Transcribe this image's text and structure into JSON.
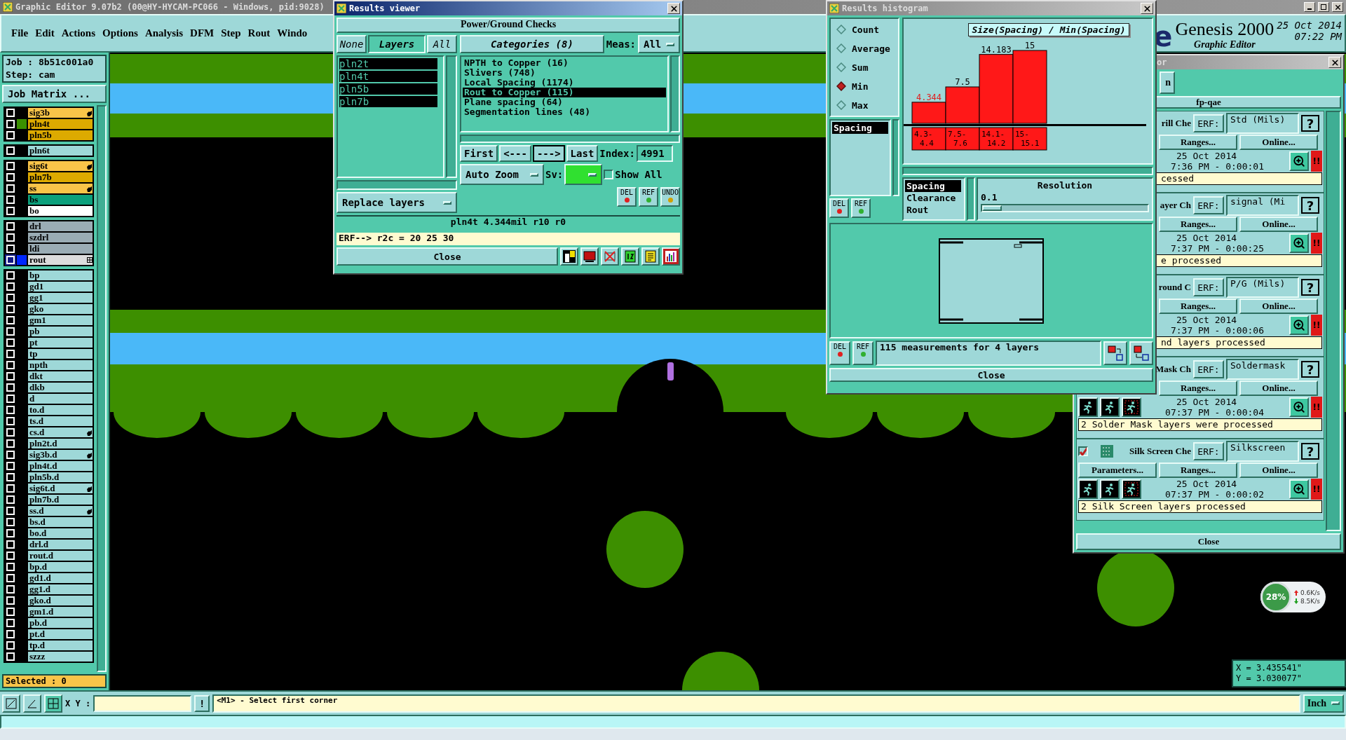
{
  "window": {
    "title": "Graphic Editor 9.07b2 (00@HY-HYCAM-PC066 - Windows, pid:9028)"
  },
  "menu": [
    "File",
    "Edit",
    "Actions",
    "Options",
    "Analysis",
    "DFM",
    "Step",
    "Rout",
    "Windo"
  ],
  "logo": {
    "fragment": "e",
    "name": "Genesis 2000",
    "subtitle": "Graphic Editor",
    "date": "25 Oct 2014",
    "time": "07:22 PM"
  },
  "job_panel": {
    "job": "Job : 8b51c001a0",
    "step": "Step: cam",
    "matrix_button": "Job Matrix ...",
    "selected_count": "Selected : 0",
    "layer_groups": [
      [
        {
          "name": "sig3b",
          "color": "#f9c449",
          "checked": false,
          "shown": false,
          "work": false,
          "flagged": true
        },
        {
          "name": "pln4t",
          "color": "#ddaa00",
          "checked": false,
          "shown": true,
          "work": false,
          "flagged": false
        },
        {
          "name": "pln5b",
          "color": "#ddaa00",
          "checked": false,
          "shown": false,
          "work": false,
          "flagged": false
        }
      ],
      [
        {
          "name": "pln6t",
          "color": "#9ed8d8",
          "checked": false,
          "shown": false,
          "work": false,
          "flagged": false
        }
      ],
      [
        {
          "name": "sig6t",
          "color": "#f9c449",
          "checked": false,
          "shown": false,
          "work": false,
          "flagged": true
        },
        {
          "name": "pln7b",
          "color": "#ddaa00",
          "checked": false,
          "shown": false,
          "work": false,
          "flagged": false
        },
        {
          "name": "ss",
          "color": "#f9c449",
          "checked": false,
          "shown": false,
          "work": false,
          "flagged": true
        },
        {
          "name": "bs",
          "color": "#0ca07c",
          "checked": false,
          "shown": false,
          "work": false,
          "flagged": false
        },
        {
          "name": "bo",
          "color": "#ffffff",
          "checked": false,
          "shown": false,
          "work": false,
          "flagged": false
        }
      ],
      [
        {
          "name": "drl",
          "color": "#9aacb4",
          "checked": false,
          "shown": false,
          "work": false,
          "flagged": false
        },
        {
          "name": "szdrl",
          "color": "#9aacb4",
          "checked": false,
          "shown": false,
          "work": false,
          "flagged": false
        },
        {
          "name": "ldi",
          "color": "#9aacb4",
          "checked": false,
          "shown": false,
          "work": false,
          "flagged": false
        },
        {
          "name": "rout",
          "color": "#dcdcdc",
          "checked": false,
          "shown": false,
          "work": true,
          "flagged": false
        }
      ],
      [
        {
          "name": "bp",
          "color": "#9ed8d8",
          "checked": false,
          "shown": false,
          "work": false,
          "flagged": false
        },
        {
          "name": "gd1",
          "color": "#9ed8d8",
          "checked": false,
          "shown": false,
          "work": false,
          "flagged": false
        },
        {
          "name": "gg1",
          "color": "#9ed8d8",
          "checked": false,
          "shown": false,
          "work": false,
          "flagged": false
        },
        {
          "name": "gko",
          "color": "#9ed8d8",
          "checked": false,
          "shown": false,
          "work": false,
          "flagged": false
        },
        {
          "name": "gm1",
          "color": "#9ed8d8",
          "checked": false,
          "shown": false,
          "work": false,
          "flagged": false
        },
        {
          "name": "pb",
          "color": "#9ed8d8",
          "checked": false,
          "shown": false,
          "work": false,
          "flagged": false
        },
        {
          "name": "pt",
          "color": "#9ed8d8",
          "checked": false,
          "shown": false,
          "work": false,
          "flagged": false
        },
        {
          "name": "tp",
          "color": "#9ed8d8",
          "checked": false,
          "shown": false,
          "work": false,
          "flagged": false
        },
        {
          "name": "npth",
          "color": "#9ed8d8",
          "checked": false,
          "shown": false,
          "work": false,
          "flagged": false
        },
        {
          "name": "dkt",
          "color": "#9ed8d8",
          "checked": false,
          "shown": false,
          "work": false,
          "flagged": false
        },
        {
          "name": "dkb",
          "color": "#9ed8d8",
          "checked": false,
          "shown": false,
          "work": false,
          "flagged": false
        },
        {
          "name": "d",
          "color": "#9ed8d8",
          "checked": false,
          "shown": false,
          "work": false,
          "flagged": false
        },
        {
          "name": "to.d",
          "color": "#9ed8d8",
          "checked": false,
          "shown": false,
          "work": false,
          "flagged": false
        },
        {
          "name": "ts.d",
          "color": "#9ed8d8",
          "checked": false,
          "shown": false,
          "work": false,
          "flagged": false
        },
        {
          "name": "cs.d",
          "color": "#9ed8d8",
          "checked": false,
          "shown": false,
          "work": false,
          "flagged": true
        },
        {
          "name": "pln2t.d",
          "color": "#9ed8d8",
          "checked": false,
          "shown": false,
          "work": false,
          "flagged": false
        },
        {
          "name": "sig3b.d",
          "color": "#9ed8d8",
          "checked": false,
          "shown": false,
          "work": false,
          "flagged": true
        },
        {
          "name": "pln4t.d",
          "color": "#9ed8d8",
          "checked": false,
          "shown": false,
          "work": false,
          "flagged": false
        },
        {
          "name": "pln5b.d",
          "color": "#9ed8d8",
          "checked": false,
          "shown": false,
          "work": false,
          "flagged": false
        },
        {
          "name": "sig6t.d",
          "color": "#9ed8d8",
          "checked": false,
          "shown": false,
          "work": false,
          "flagged": true
        },
        {
          "name": "pln7b.d",
          "color": "#9ed8d8",
          "checked": false,
          "shown": false,
          "work": false,
          "flagged": false
        },
        {
          "name": "ss.d",
          "color": "#9ed8d8",
          "checked": false,
          "shown": false,
          "work": false,
          "flagged": true
        },
        {
          "name": "bs.d",
          "color": "#9ed8d8",
          "checked": false,
          "shown": false,
          "work": false,
          "flagged": false
        },
        {
          "name": "bo.d",
          "color": "#9ed8d8",
          "checked": false,
          "shown": false,
          "work": false,
          "flagged": false
        },
        {
          "name": "drl.d",
          "color": "#9ed8d8",
          "checked": false,
          "shown": false,
          "work": false,
          "flagged": false
        },
        {
          "name": "rout.d",
          "color": "#9ed8d8",
          "checked": false,
          "shown": false,
          "work": false,
          "flagged": false
        },
        {
          "name": "bp.d",
          "color": "#9ed8d8",
          "checked": false,
          "shown": false,
          "work": false,
          "flagged": false
        },
        {
          "name": "gd1.d",
          "color": "#9ed8d8",
          "checked": false,
          "shown": false,
          "work": false,
          "flagged": false
        },
        {
          "name": "gg1.d",
          "color": "#9ed8d8",
          "checked": false,
          "shown": false,
          "work": false,
          "flagged": false
        },
        {
          "name": "gko.d",
          "color": "#9ed8d8",
          "checked": false,
          "shown": false,
          "work": false,
          "flagged": false
        },
        {
          "name": "gm1.d",
          "color": "#9ed8d8",
          "checked": false,
          "shown": false,
          "work": false,
          "flagged": false
        },
        {
          "name": "pb.d",
          "color": "#9ed8d8",
          "checked": false,
          "shown": false,
          "work": false,
          "flagged": false
        },
        {
          "name": "pt.d",
          "color": "#9ed8d8",
          "checked": false,
          "shown": false,
          "work": false,
          "flagged": false
        },
        {
          "name": "tp.d",
          "color": "#9ed8d8",
          "checked": false,
          "shown": false,
          "work": false,
          "flagged": false
        },
        {
          "name": "szzz",
          "color": "#9ed8d8",
          "checked": false,
          "shown": false,
          "work": false,
          "flagged": false
        }
      ]
    ]
  },
  "results_viewer": {
    "title": "Results viewer",
    "header": "Power/Ground Checks",
    "layer_tabs": [
      {
        "label": "None",
        "selected": false
      },
      {
        "label": "Layers",
        "selected": true
      },
      {
        "label": "All",
        "selected": false
      }
    ],
    "layers": [
      {
        "name": "pln2t",
        "selected": true
      },
      {
        "name": "pln4t",
        "selected": true
      },
      {
        "name": "pln5b",
        "selected": true
      },
      {
        "name": "pln7b",
        "selected": true
      }
    ],
    "layer_action": "Replace layers",
    "categories_title": "Categories (8)",
    "meas_label": "Meas:",
    "meas_value": "All",
    "categories": [
      {
        "label": "NPTH to Copper (16)",
        "selected": false
      },
      {
        "label": "Slivers (748)",
        "selected": false
      },
      {
        "label": "Local Spacing (1174)",
        "selected": false
      },
      {
        "label": "Rout to Copper (115)",
        "selected": true
      },
      {
        "label": "Plane spacing (64)",
        "selected": false
      },
      {
        "label": "Segmentation lines (48)",
        "selected": false
      }
    ],
    "nav": [
      {
        "label": "First",
        "selected": false
      },
      {
        "label": "<---",
        "selected": false
      },
      {
        "label": "--->",
        "selected": true
      },
      {
        "label": "Last",
        "selected": false
      }
    ],
    "index_label": "Index:",
    "index_value": "4991",
    "zoom_mode": "Auto Zoom",
    "sv_label": "Sv:",
    "show_all": {
      "label": "Show All",
      "checked": false
    },
    "tool_buttons": [
      "DEL",
      "REF",
      "UNDO"
    ],
    "info": "pln4t 4.344mil r10 r0",
    "erf": "ERF--> r2c = 20 25 30",
    "close": "Close"
  },
  "histogram": {
    "title": "Results histogram",
    "modes": [
      {
        "label": "Count",
        "selected": false
      },
      {
        "label": "Average",
        "selected": false
      },
      {
        "label": "Sum",
        "selected": false
      },
      {
        "label": "Min",
        "selected": true
      },
      {
        "label": "Max",
        "selected": false
      }
    ],
    "measures": [
      {
        "label": "Spacing",
        "selected": true
      }
    ],
    "chart_data": {
      "type": "bar",
      "title": "Size(Spacing) / Min(Spacing)",
      "categories": [
        "4.3- 4.4",
        "7.5- 7.6",
        "14.1- 14.2",
        "15- 15.1"
      ],
      "values": [
        4.344,
        7.5,
        14.183,
        15
      ],
      "data_labels": true
    },
    "types": [
      {
        "label": "Spacing",
        "selected": true
      },
      {
        "label": "Clearance",
        "selected": false
      },
      {
        "label": "Rout",
        "selected": false
      }
    ],
    "resolution_label": "Resolution",
    "resolution_value": "0.1",
    "resolution": {
      "level": 0.0
    },
    "list_buttons": [
      "DEL",
      "REF"
    ],
    "summary_buttons": [
      "DEL",
      "REF"
    ],
    "summary": "115 measurements for 4 layers",
    "close": "Close"
  },
  "checks_window": {
    "title": "or",
    "top_button": "n",
    "header": "fp-qae",
    "checks": [
      {
        "name": "rill Che",
        "erf": "ERF:",
        "preset": "Std (Mils)",
        "help": "?",
        "buttons": [
          "Ranges...",
          "Online..."
        ],
        "date": "25 Oct 2014",
        "time": "7:36 PM - 0:00:01",
        "alert": "!!",
        "message": "cessed"
      },
      {
        "name": "ayer Ch",
        "erf": "ERF:",
        "preset": "signal (Mi",
        "help": "?",
        "buttons": [
          "Ranges...",
          "Online..."
        ],
        "date": "25 Oct 2014",
        "time": "7:37 PM - 0:00:25",
        "alert": "!!",
        "message": "e processed"
      },
      {
        "name": "round C",
        "erf": "ERF:",
        "preset": "P/G (Mils)",
        "help": "?",
        "buttons": [
          "Ranges...",
          "Online..."
        ],
        "date": "25 Oct 2014",
        "time": "7:37 PM - 0:00:06",
        "alert": "!!",
        "message": "nd layers processed"
      },
      {
        "name": "Mask Ch",
        "erf": "ERF:",
        "preset": "Soldermask",
        "help": "?",
        "buttons": [
          "Ranges...",
          "Online..."
        ],
        "tools": true,
        "date": "25 Oct 2014",
        "time": "07:37 PM - 0:00:04",
        "alert": "!!",
        "message": "2 Solder Mask layers were processed"
      },
      {
        "checked": true,
        "name": "Silk Screen Che",
        "erf": "ERF:",
        "preset": "Silkscreen",
        "help": "?",
        "buttons": [
          "Parameters...",
          "Ranges...",
          "Online..."
        ],
        "tools": true,
        "date": "25 Oct 2014",
        "time": "07:37 PM - 0:00:02",
        "alert": "!!",
        "message": "2 Silk Screen layers processed"
      }
    ],
    "close": "Close"
  },
  "network": {
    "percent": "28%",
    "up": "0.6K/s",
    "down": "8.5K/s"
  },
  "cursor": {
    "x": "X = 3.435541\"",
    "y": "Y = 3.030077\""
  },
  "command_bar": {
    "xy_label": "X Y :",
    "bang": "!",
    "prompt": "<M1> - Select first corner",
    "units": "Inch"
  }
}
